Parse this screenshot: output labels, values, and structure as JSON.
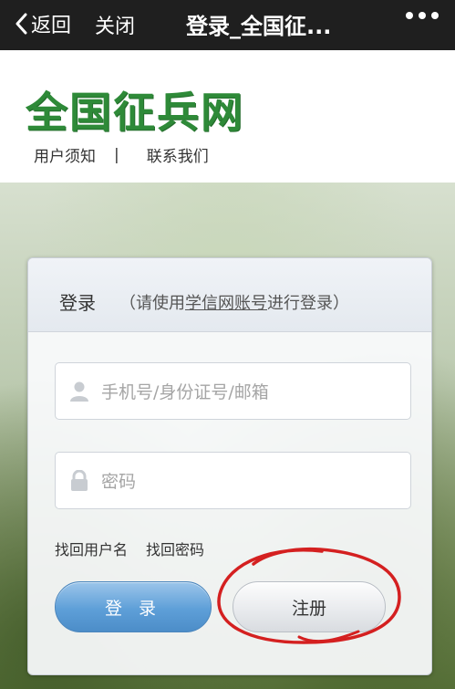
{
  "nav": {
    "back_label": "返回",
    "close_label": "关闭",
    "title": "登录_全国征...",
    "more_icon": "more-dots-icon"
  },
  "header": {
    "logo_text": "全国征兵网",
    "links": [
      {
        "label": "用户须知"
      },
      {
        "label": "联系我们"
      }
    ],
    "separator": "|"
  },
  "login": {
    "title": "登录",
    "subtitle_prefix": "（请使用",
    "subtitle_link": "学信网账号",
    "subtitle_suffix": "进行登录）",
    "username_placeholder": "手机号/身份证号/邮箱",
    "password_placeholder": "密码",
    "forgot_username": "找回用户名",
    "forgot_password": "找回密码",
    "login_button": "登 录",
    "register_button": "注册"
  },
  "colors": {
    "topbar": "#1f1f1f",
    "logo_green": "#2e8a38",
    "login_blue": "#5e9fd8",
    "circle_red": "#d42020"
  }
}
